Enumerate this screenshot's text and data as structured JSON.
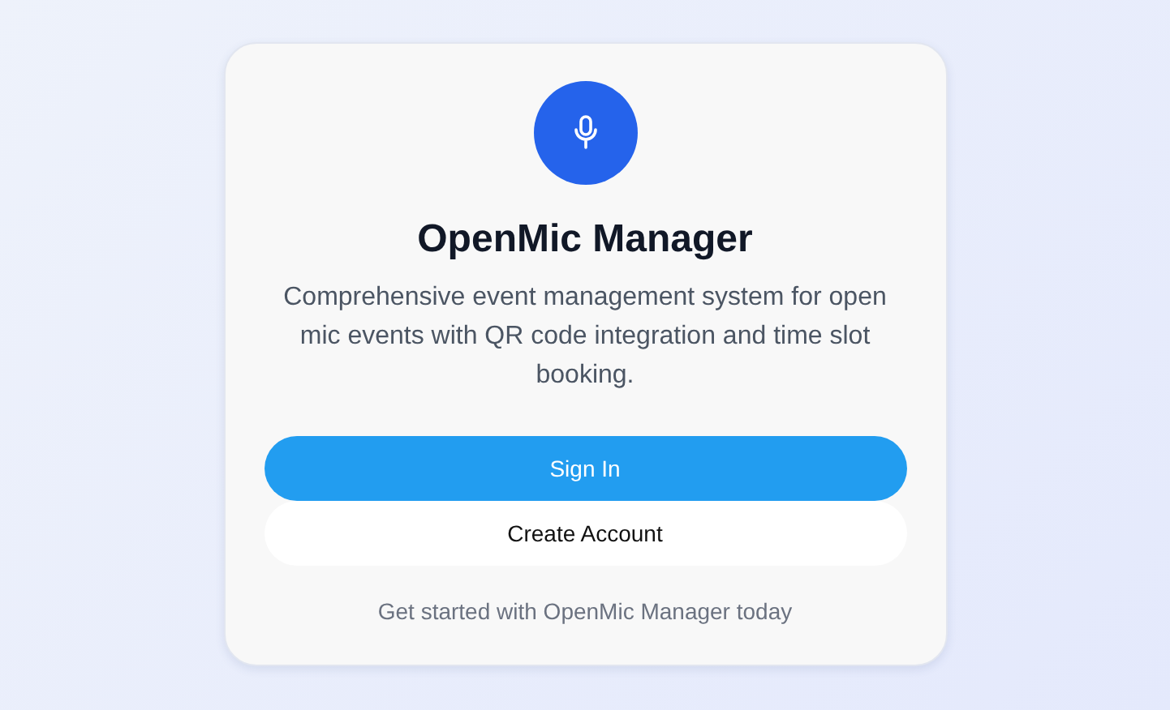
{
  "title": "OpenMic Manager",
  "description": "Comprehensive event management system for open mic events with QR code integration and time slot booking.",
  "buttons": [
    {
      "label": "Sign In",
      "kind": "primary"
    },
    {
      "label": "Create Account",
      "kind": "secondary"
    }
  ],
  "footer": "Get started with OpenMic Manager today"
}
